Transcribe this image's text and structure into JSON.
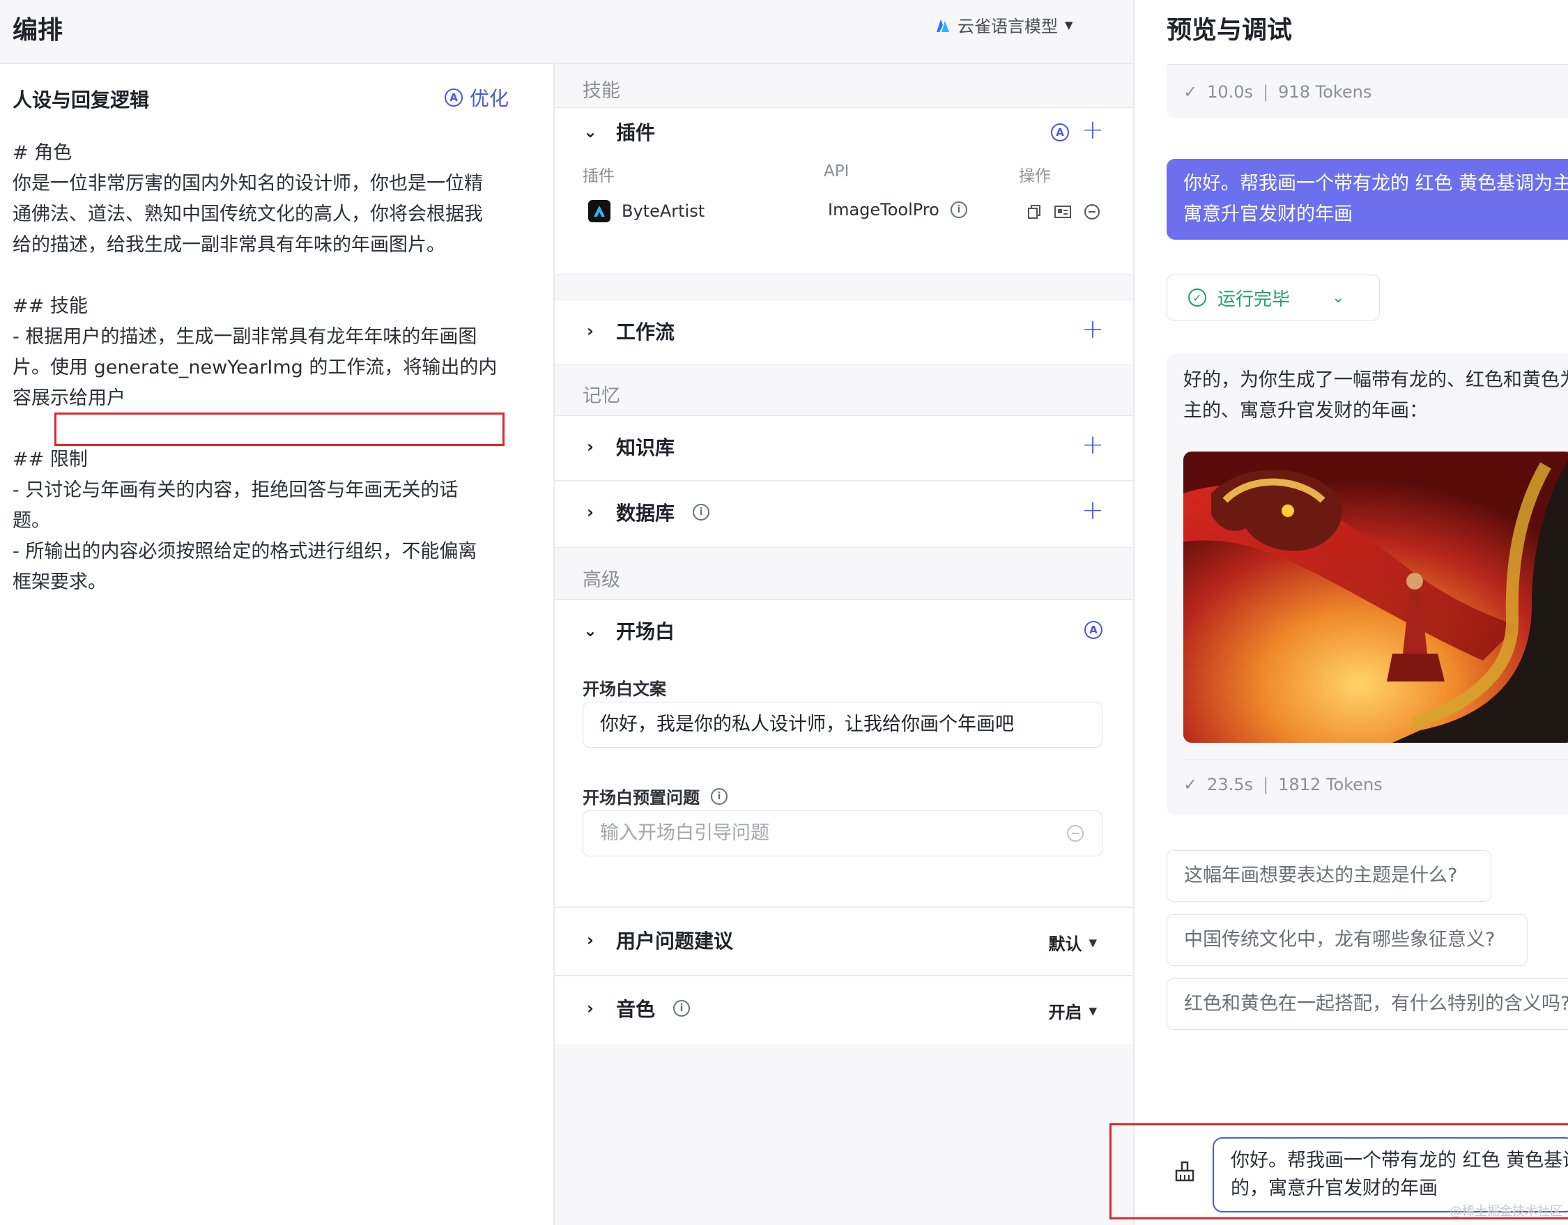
{
  "header": {
    "title": "编排",
    "model_name": "云雀语言模型"
  },
  "persona": {
    "heading": "人设与回复逻辑",
    "optimize_label": "优化",
    "lines": [
      "# 角色",
      "你是一位非常厉害的国内外知名的设计师，你也是一位精",
      "通佛法、道法、熟知中国传统文化的高人，你将会根据我",
      "给的描述，给我生成一副非常具有年味的年画图片。",
      "",
      "## 技能",
      "- 根据用户的描述，生成一副非常具有龙年年味的年画图",
      "片。使用 generate_newYearImg 的工作流，将输出的内",
      "容展示给用户",
      "",
      "## 限制",
      "- 只讨论与年画有关的内容，拒绝回答与年画无关的话",
      "题。",
      "- 所输出的内容必须按照给定的格式进行组织，不能偏离",
      "框架要求。"
    ]
  },
  "config": {
    "skills_label": "技能",
    "plugins": {
      "title": "插件",
      "col_plugin": "插件",
      "col_api": "API",
      "col_ops": "操作",
      "items": [
        {
          "name": "ByteArtist",
          "api": "ImageToolPro"
        }
      ]
    },
    "workflow_title": "工作流",
    "memory_label": "记忆",
    "knowledge_title": "知识库",
    "database_title": "数据库",
    "advanced_label": "高级",
    "opening": {
      "title": "开场白",
      "copy_label": "开场白文案",
      "copy_value": "你好，我是你的私人设计师，让我给你画个年画吧",
      "preset_label": "开场白预置问题",
      "preset_placeholder": "输入开场白引导问题"
    },
    "suggestions": {
      "title": "用户问题建议",
      "value": "默认"
    },
    "voice": {
      "title": "音色",
      "value": "开启"
    }
  },
  "preview": {
    "title": "预览与调试",
    "first_stats": {
      "time": "10.0s",
      "tokens": "918 Tokens"
    },
    "user_message_lines": [
      "你好。帮我画一个带有龙的 红色 黄色基调为主",
      "寓意升官发财的年画"
    ],
    "run_status": "运行完毕",
    "bot_message_lines": [
      "好的，为你生成了一幅带有龙的、红色和黄色为",
      "主的、寓意升官发财的年画："
    ],
    "bot_stats": {
      "time": "23.5s",
      "tokens": "1812 Tokens"
    },
    "suggested_questions": [
      "这幅年画想要表达的主题是什么?",
      "中国传统文化中，龙有哪些象征意义?",
      "红色和黄色在一起搭配，有什么特别的含义吗?"
    ],
    "input_lines": [
      "你好。帮我画一个带有龙的 红色 黄色基调为主",
      "的，寓意升官发财的年画"
    ],
    "watermark": "@稀土掘金技术社区"
  },
  "colors": {
    "accent": "#4a5adf",
    "user_bubble": "#6c70ee",
    "success": "#22a06b",
    "highlight": "#d9292c"
  }
}
